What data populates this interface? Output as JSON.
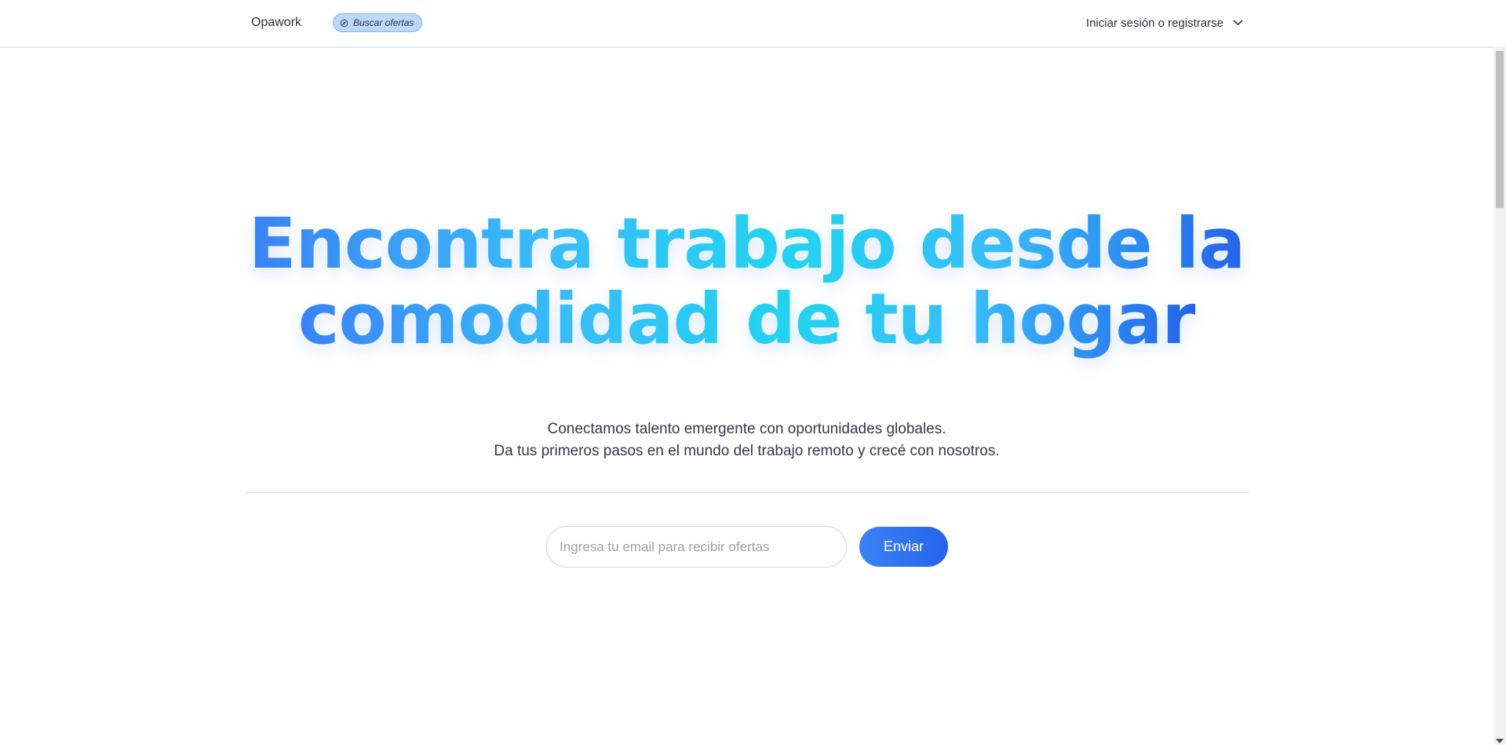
{
  "header": {
    "brand": "Opawork",
    "search_pill_label": "Buscar ofertas",
    "search_pill_icon": "compass-icon",
    "login_label": "Iniciar sesión o registrarse",
    "login_icon": "chevron-down-icon"
  },
  "hero": {
    "title_line1": "Encontra trabajo desde la",
    "title_line2": "comodidad de tu hogar",
    "subtitle_line1": "Conectamos talento emergente con oportunidades globales.",
    "subtitle_line2": "Da tus primeros pasos en el mundo del trabajo remoto y crecé con nosotros."
  },
  "signup": {
    "email_placeholder": "Ingresa tu email para recibir ofertas",
    "email_value": "",
    "submit_label": "Enviar"
  },
  "colors": {
    "accent": "#3b82f6",
    "accent_dark": "#2563eb",
    "accent_cyan": "#22d3ee",
    "pill_bg": "#bcd9fb"
  }
}
